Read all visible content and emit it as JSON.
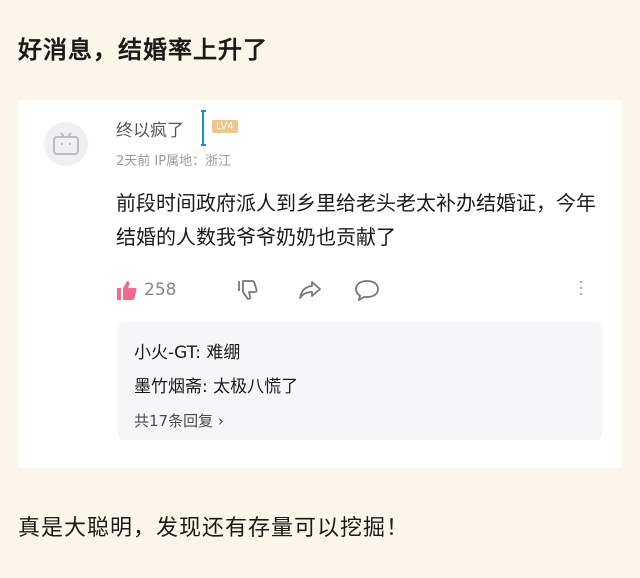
{
  "headline": "好消息，结婚率上升了",
  "comment": {
    "username": "终以疯了",
    "badge": "LV4",
    "meta": "2天前 IP属地：浙江",
    "text": "前段时间政府派人到乡里给老头老太补办结婚证，今年结婚的人数我爷爷奶奶也贡献了",
    "likes": "258"
  },
  "replies": [
    {
      "name": "小火-GT:",
      "text": " 难绷"
    },
    {
      "name": "墨竹烟斋:",
      "text": " 太极八慌了"
    }
  ],
  "reply_more": "共17条回复 ›",
  "footline": "真是大聪明，发现还有存量可以挖掘！"
}
